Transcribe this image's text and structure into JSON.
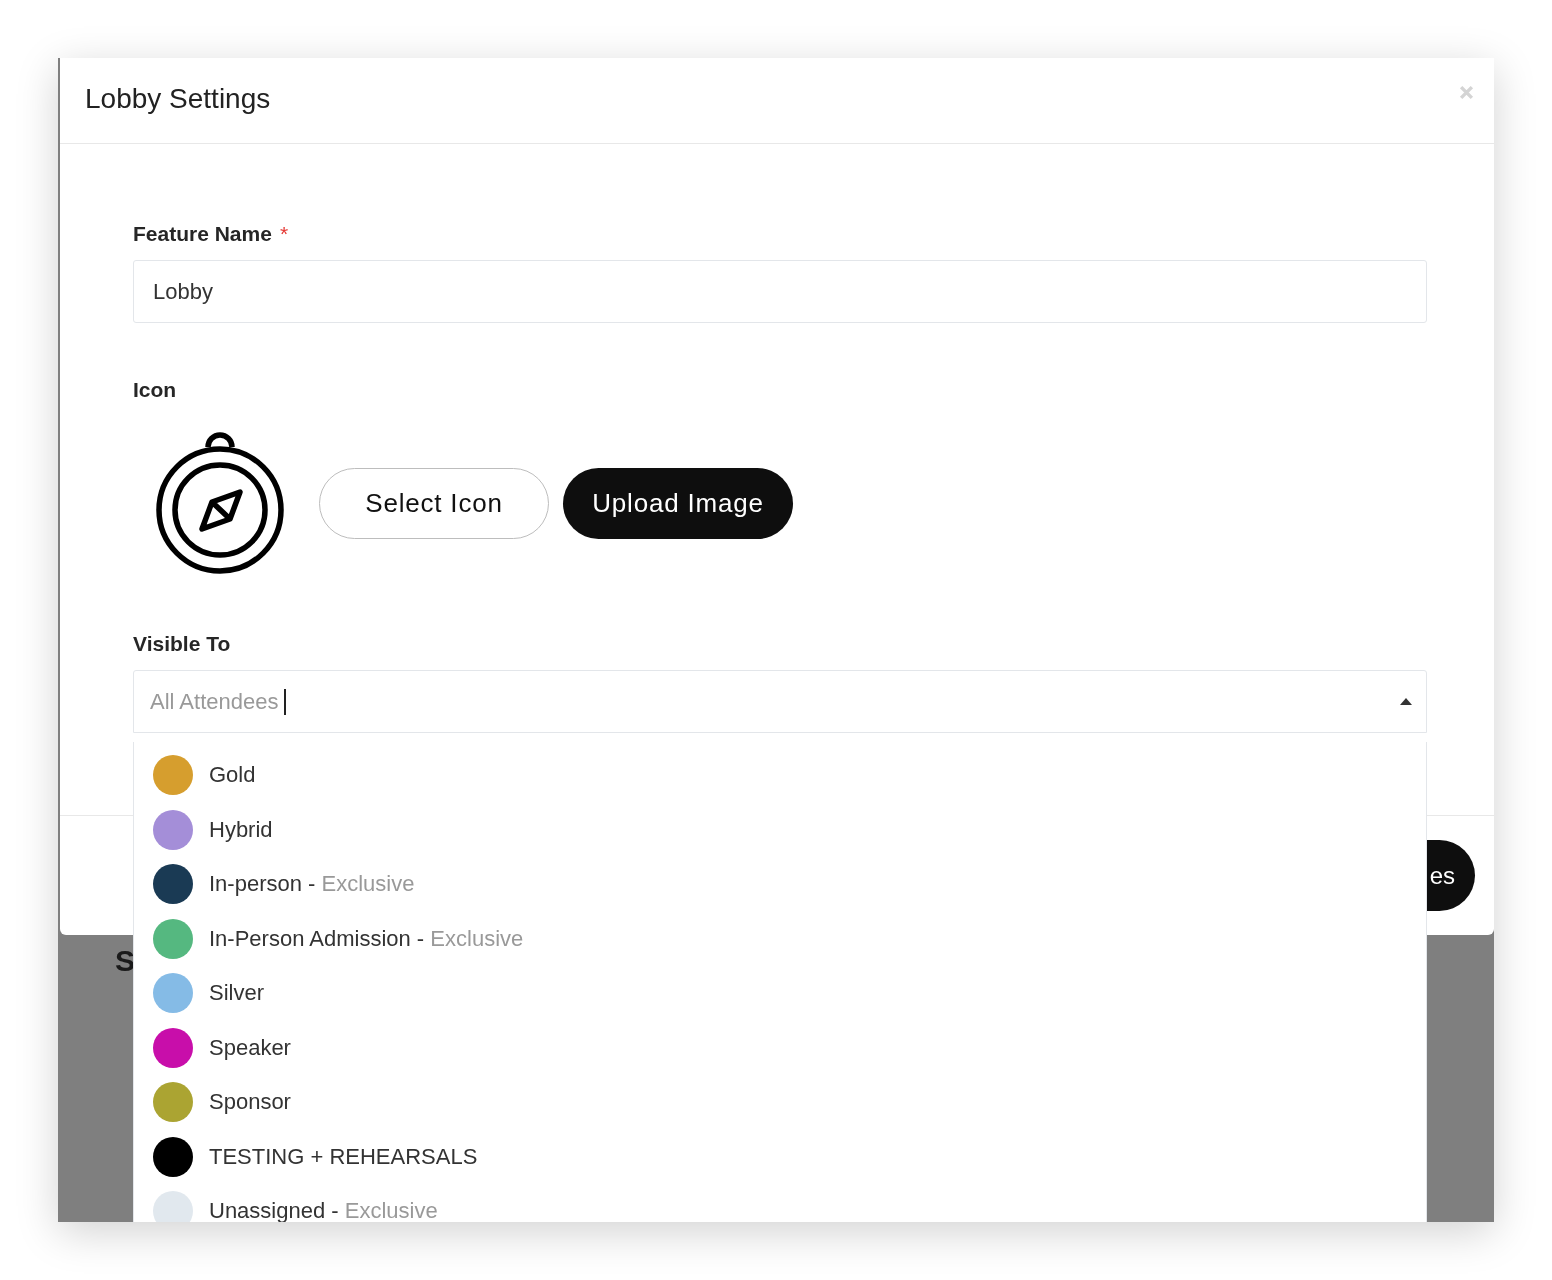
{
  "dialog": {
    "title": "Lobby Settings",
    "feature_name": {
      "label": "Feature Name",
      "required_mark": "*",
      "value": "Lobby"
    },
    "icon": {
      "label": "Icon",
      "buttons": [
        {
          "label": "Select Icon",
          "kind": "outline"
        },
        {
          "label": "Upload Image",
          "kind": "filled"
        }
      ]
    },
    "visible_to": {
      "label": "Visible To",
      "placeholder": "All Attendees",
      "expanded": true,
      "options": [
        {
          "label": "Gold",
          "color": "#d69e2e"
        },
        {
          "label": "Hybrid",
          "color": "#a48ed8"
        },
        {
          "label": "In-person -",
          "note": "Exclusive",
          "color": "#1a3a54"
        },
        {
          "label": "In-Person Admission -",
          "note": "Exclusive",
          "color": "#55b880"
        },
        {
          "label": "Silver",
          "color": "#85bbe6"
        },
        {
          "label": "Speaker",
          "color": "#c80eaa"
        },
        {
          "label": "Sponsor",
          "color": "#aba432"
        },
        {
          "label": "TESTING + REHEARSALS",
          "color": "#000000"
        },
        {
          "label": "Unassigned -",
          "note": "Exclusive",
          "color": "#e1e8ee"
        }
      ]
    },
    "footer": {
      "buttons": [
        {
          "label": "es"
        }
      ]
    }
  },
  "background": {
    "heading": "S"
  }
}
